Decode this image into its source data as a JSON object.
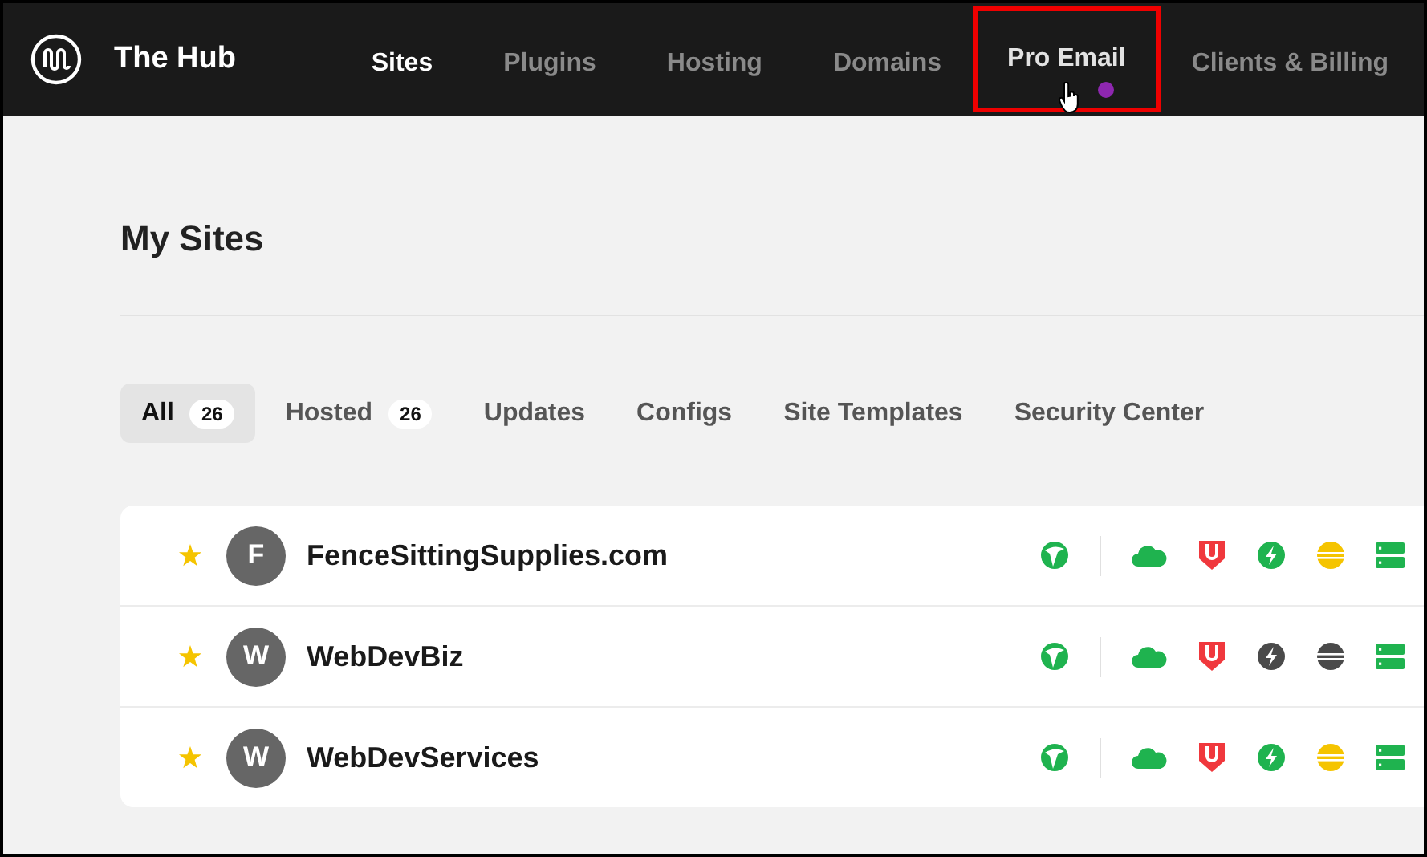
{
  "app": {
    "title": "The Hub"
  },
  "nav": [
    {
      "label": "Sites",
      "selected": true,
      "highlighted": false,
      "dot": false
    },
    {
      "label": "Plugins",
      "selected": false,
      "highlighted": false,
      "dot": false
    },
    {
      "label": "Hosting",
      "selected": false,
      "highlighted": false,
      "dot": false
    },
    {
      "label": "Domains",
      "selected": false,
      "highlighted": false,
      "dot": false
    },
    {
      "label": "Pro Email",
      "selected": false,
      "highlighted": true,
      "dot": true
    },
    {
      "label": "Clients & Billing",
      "selected": false,
      "highlighted": false,
      "dot": false
    }
  ],
  "page_title": "My Sites",
  "tabs": [
    {
      "label": "All",
      "count": "26",
      "selected": true
    },
    {
      "label": "Hosted",
      "count": "26",
      "selected": false
    },
    {
      "label": "Updates",
      "selected": false
    },
    {
      "label": "Configs",
      "selected": false
    },
    {
      "label": "Site Templates",
      "selected": false
    },
    {
      "label": "Security Center",
      "selected": false
    }
  ],
  "sites": [
    {
      "initial": "F",
      "name": "FenceSittingSupplies.com",
      "starred": true,
      "performance_active": true,
      "uptime_active": true
    },
    {
      "initial": "W",
      "name": "WebDevBiz",
      "starred": true,
      "performance_active": false,
      "uptime_active": false
    },
    {
      "initial": "W",
      "name": "WebDevServices",
      "starred": true,
      "performance_active": true,
      "uptime_active": true
    }
  ]
}
